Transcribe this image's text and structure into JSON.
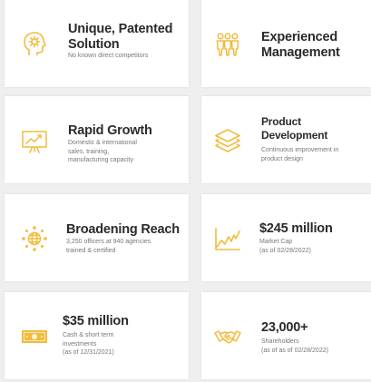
{
  "colors": {
    "accent": "#f2bb3d",
    "background": "#efefef",
    "card": "#ffffff",
    "title": "#2b2b2b",
    "subtitle": "#777777"
  },
  "cards": [
    {
      "icon": "head-gear-icon",
      "title_lines": [
        "Unique, Patented",
        "Solution"
      ],
      "sub_lines": [
        "No known direct competitors"
      ]
    },
    {
      "icon": "team-people-icon",
      "title_lines": [
        "Experienced",
        "Management"
      ],
      "sub_lines": []
    },
    {
      "icon": "growth-chart-board-icon",
      "title_lines": [
        "Rapid Growth"
      ],
      "sub_lines": [
        "Domestic & international",
        "sales, training,",
        "manufacturing capacity"
      ]
    },
    {
      "icon": "layers-stack-icon",
      "title_lines": [
        "Product",
        "Development"
      ],
      "sub_lines": [
        "Continuous improvement in",
        "product design"
      ]
    },
    {
      "icon": "globe-reach-icon",
      "title_lines": [
        "Broadening Reach"
      ],
      "sub_lines": [
        "3,250 officers at 940 agencies",
        "trained & certified"
      ]
    },
    {
      "icon": "market-cap-chart-icon",
      "title_lines": [
        "$245 million"
      ],
      "sub_lines": [
        "Market Cap",
        "(as of 02/28/2022)"
      ]
    },
    {
      "icon": "cash-bill-icon",
      "title_lines": [
        "$35 million"
      ],
      "sub_lines": [
        "Cash & short term",
        "investments",
        "(as of 12/31/2021)"
      ]
    },
    {
      "icon": "handshake-icon",
      "title_lines": [
        "23,000+"
      ],
      "sub_lines": [
        "Shareholders",
        "(as of as of 02/28/2022)"
      ]
    }
  ]
}
